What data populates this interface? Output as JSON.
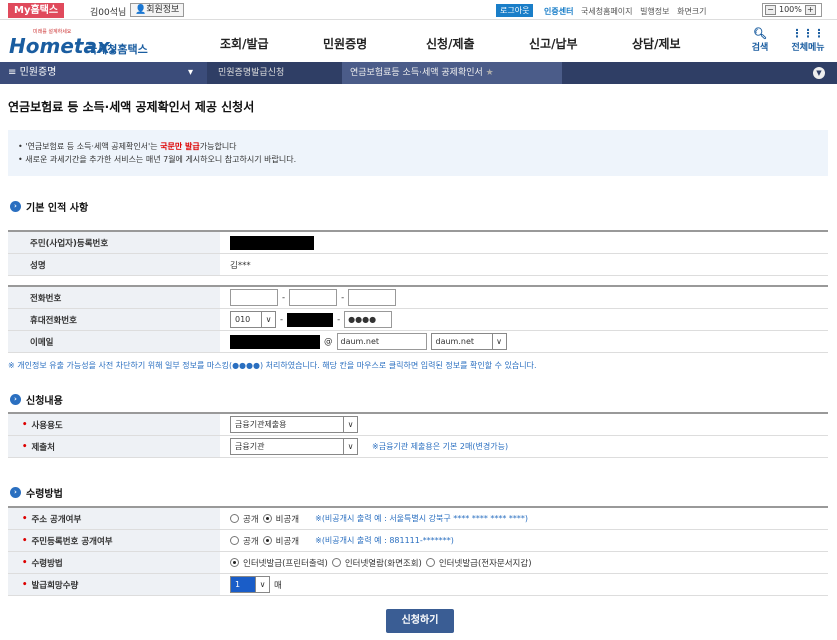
{
  "topbar": {
    "myhome": "My홈택스",
    "user_name": "김00석님",
    "member_info": "회원정보",
    "logout": "로그아웃",
    "links": [
      "인증센터",
      "국세청홈페이지",
      "빌행정보",
      "화면크기"
    ],
    "zoom": "100%"
  },
  "logo": {
    "tagline": "미래를 설계하세요",
    "brand": "Hometax.",
    "brand_kr": "국세청홈택스"
  },
  "menu": [
    "조회/발급",
    "민원증명",
    "신청/제출",
    "신고/납부",
    "상담/제보"
  ],
  "search_label": "검색",
  "allmenu_label": "전체메뉴",
  "breadcrumb": {
    "main": "민원증명",
    "sub1": "민원증명발급신청",
    "sub2": "연금보험료등 소득·세액 공제확인서"
  },
  "page_title": "연금보험료 등 소득·세액 공제확인서 제공 신청서",
  "notice": {
    "line1_a": "'연금보험료 등 소득·세액 공제확인서'는 ",
    "line1_red": "국문만 발급",
    "line1_b": "가능합니다",
    "line2": "새로운 과세기간을 추가한 서비스는 매년 7월에 게시하오니 참고하시기 바랍니다."
  },
  "sections": {
    "basic": "기본 인적 사항",
    "apply": "신청내용",
    "receive": "수령방법"
  },
  "basic": {
    "rrn_label": "주민(사업자)등록번호",
    "name_label": "성명",
    "name_value": "김***",
    "phone_label": "전화번호",
    "mobile_label": "휴대전화번호",
    "mobile_prefix": "010",
    "mobile_last": "●●●●",
    "email_label": "이메일",
    "email_at": "@",
    "email_domain": "daum.net",
    "email_select": "daum.net"
  },
  "mask_info": "※ 개인정보 유출 가능성을 사전 차단하기 위해 일부 정보를 마스킹(●●●●) 처리하였습니다. 해당 칸을 마우스로 클릭하면 입력된 정보를 확인할 수 있습니다.",
  "apply": {
    "usage_label": "사용용도",
    "usage_value": "금융기관제출용",
    "submit_to_label": "제출처",
    "submit_to_value": "금융기관",
    "submit_note": "※금융기관 제출용은 기본 2매(변경가능)"
  },
  "receive": {
    "addr_label": "주소 공개여부",
    "rrn_label": "주민등록번호 공개여부",
    "method_label": "수령방법",
    "copies_label": "발급희망수량",
    "public": "공개",
    "private": "비공개",
    "addr_note": "※(비공개시 출력 예 : 서울특별시 강북구 **** **** **** ****)",
    "rrn_note": "※(비공개시 출력 예 : 881111-*******)",
    "m1": "인터넷발급(프린터출력)",
    "m2": "인터넷열람(화면조회)",
    "m3": "인터넷발급(전자문서지갑)",
    "copies_value": "1",
    "copies_unit": "매"
  },
  "submit_button": "신청하기"
}
